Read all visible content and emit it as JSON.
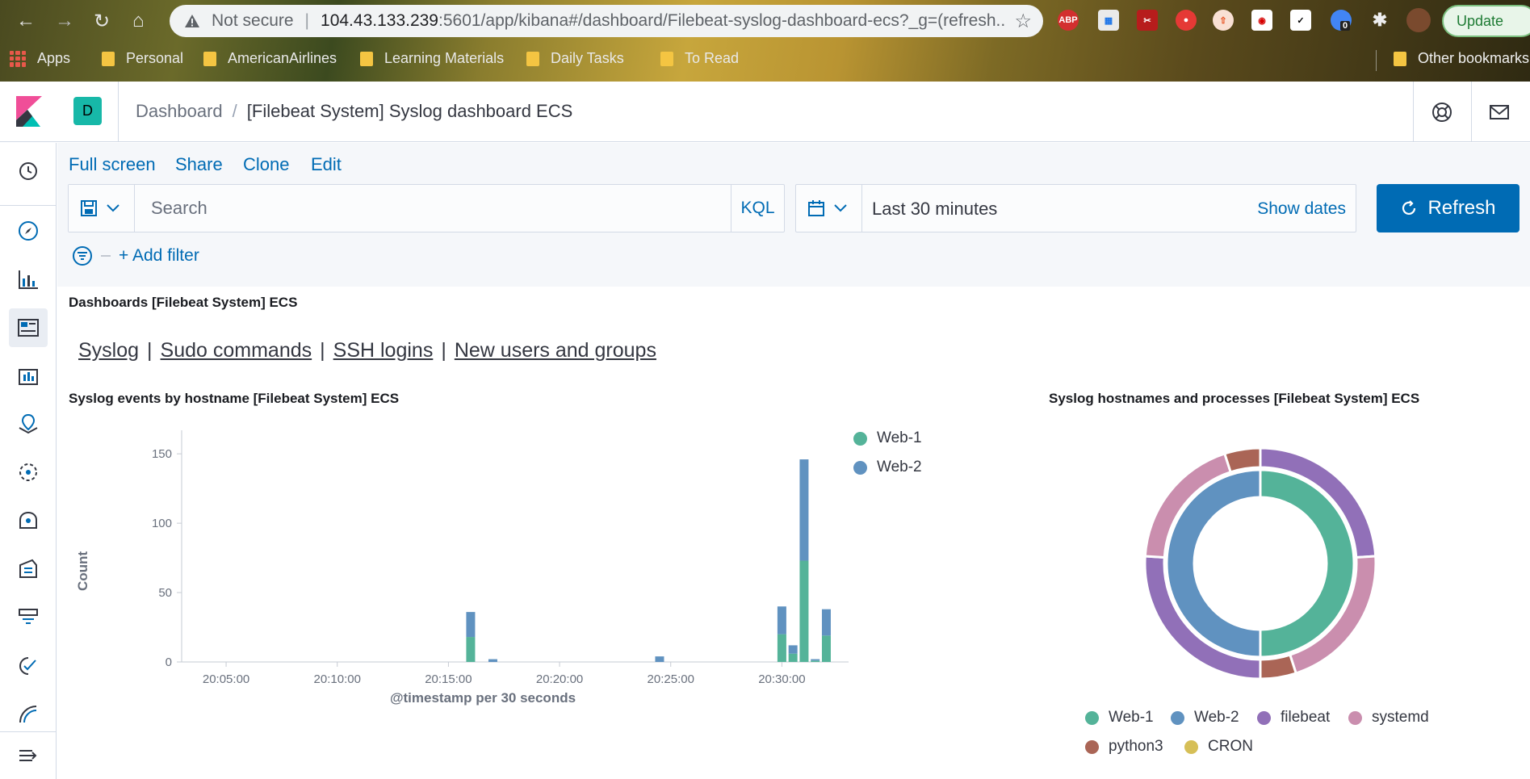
{
  "browser": {
    "security_label": "Not secure",
    "url_host": "104.43.133.239",
    "url_path": ":5601/app/kibana#/dashboard/Filebeat-syslog-dashboard-ecs?_g=(refresh...",
    "update_label": "Update",
    "ext_badge_count": "0",
    "bookmarks": [
      "Apps",
      "Personal",
      "AmericanAirlines",
      "Learning Materials",
      "Daily Tasks",
      "To Read"
    ],
    "other_bookmarks": "Other bookmarks"
  },
  "header": {
    "space_initial": "D",
    "breadcrumb_root": "Dashboard",
    "breadcrumb_separator": "/",
    "breadcrumb_current": "[Filebeat System] Syslog dashboard ECS"
  },
  "toolbar": {
    "fullscreen": "Full screen",
    "share": "Share",
    "clone": "Clone",
    "edit": "Edit"
  },
  "query": {
    "search_placeholder": "Search",
    "language": "KQL",
    "date_range": "Last 30 minutes",
    "show_dates": "Show dates",
    "refresh": "Refresh",
    "add_filter": "+ Add filter"
  },
  "panels": {
    "links_title": "Dashboards [Filebeat System] ECS",
    "links": [
      "Syslog",
      "Sudo commands",
      "SSH logins",
      "New users and groups"
    ],
    "bar_title": "Syslog events by hostname [Filebeat System] ECS",
    "donut_title": "Syslog hostnames and processes [Filebeat System] ECS"
  },
  "colors": {
    "web1": "#54b399",
    "web2": "#6092c0",
    "filebeat": "#9170b8",
    "systemd": "#ca8eae",
    "python3": "#aa6556",
    "cron": "#d6bf57",
    "accent": "#006bb4"
  },
  "chart_data": [
    {
      "type": "bar",
      "stacked": true,
      "title": "Syslog events by hostname [Filebeat System] ECS",
      "xlabel": "@timestamp per 30 seconds",
      "ylabel": "Count",
      "ylim": [
        0,
        160
      ],
      "yticks": [
        0,
        50,
        100,
        150
      ],
      "xticks": [
        "20:05:00",
        "20:10:00",
        "20:15:00",
        "20:20:00",
        "20:25:00",
        "20:30:00"
      ],
      "legend_position": "top-right",
      "x": [
        "20:16:00",
        "20:17:00",
        "20:24:30",
        "20:30:00",
        "20:30:30",
        "20:31:00",
        "20:31:30",
        "20:32:00"
      ],
      "series": [
        {
          "name": "Web-1",
          "color": "#54b399",
          "values": [
            18,
            0,
            0,
            20,
            6,
            73,
            1,
            19
          ]
        },
        {
          "name": "Web-2",
          "color": "#6092c0",
          "values": [
            18,
            2,
            4,
            20,
            6,
            73,
            1,
            19
          ]
        }
      ]
    },
    {
      "type": "pie",
      "donut": true,
      "title": "Syslog hostnames and processes [Filebeat System] ECS",
      "legend_position": "bottom",
      "legend": [
        "Web-1",
        "Web-2",
        "filebeat",
        "systemd",
        "python3",
        "CRON"
      ],
      "inner": [
        {
          "name": "Web-1",
          "color": "#54b399",
          "value": 50
        },
        {
          "name": "Web-2",
          "color": "#6092c0",
          "value": 50
        }
      ],
      "outer": [
        {
          "parent": "Web-1",
          "name": "filebeat",
          "color": "#9170b8",
          "value": 24
        },
        {
          "parent": "Web-1",
          "name": "systemd",
          "color": "#ca8eae",
          "value": 21
        },
        {
          "parent": "Web-1",
          "name": "python3",
          "color": "#aa6556",
          "value": 5
        },
        {
          "parent": "Web-2",
          "name": "filebeat",
          "color": "#9170b8",
          "value": 26
        },
        {
          "parent": "Web-2",
          "name": "systemd",
          "color": "#ca8eae",
          "value": 19
        },
        {
          "parent": "Web-2",
          "name": "python3",
          "color": "#aa6556",
          "value": 5
        }
      ]
    }
  ]
}
